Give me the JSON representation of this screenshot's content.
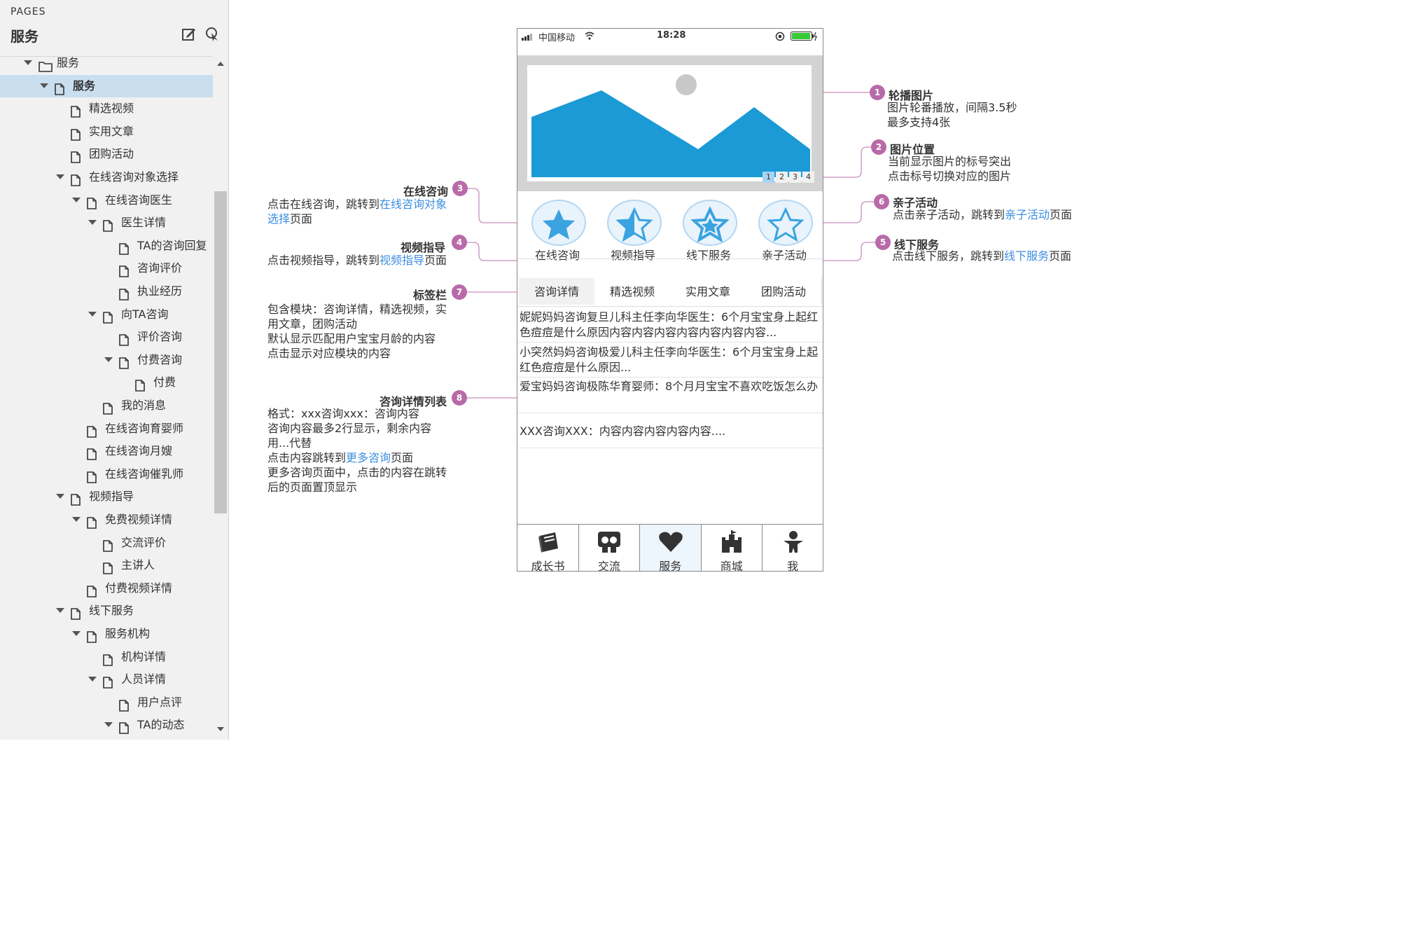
{
  "pages_panel": {
    "label": "PAGES",
    "title": "服务",
    "icons": [
      "edit-page-icon",
      "pointer-pick-icon"
    ],
    "tree": [
      {
        "label": "服务",
        "level": 0,
        "type": "folder",
        "expanded": true
      },
      {
        "label": "服务",
        "level": 1,
        "type": "page",
        "expanded": true,
        "selected": true
      },
      {
        "label": "精选视频",
        "level": 2,
        "type": "page"
      },
      {
        "label": "实用文章",
        "level": 2,
        "type": "page"
      },
      {
        "label": "团购活动",
        "level": 2,
        "type": "page"
      },
      {
        "label": "在线咨询对象选择",
        "level": 2,
        "type": "page",
        "expanded": true
      },
      {
        "label": "在线咨询医生",
        "level": 3,
        "type": "page",
        "expanded": true
      },
      {
        "label": "医生详情",
        "level": 4,
        "type": "page",
        "expanded": true
      },
      {
        "label": "TA的咨询回复",
        "level": 5,
        "type": "page"
      },
      {
        "label": "咨询评价",
        "level": 5,
        "type": "page"
      },
      {
        "label": "执业经历",
        "level": 5,
        "type": "page"
      },
      {
        "label": "向TA咨询",
        "level": 4,
        "type": "page",
        "expanded": true
      },
      {
        "label": "评价咨询",
        "level": 5,
        "type": "page"
      },
      {
        "label": "付费咨询",
        "level": 5,
        "type": "page",
        "expanded": true
      },
      {
        "label": "付费",
        "level": 6,
        "type": "page"
      },
      {
        "label": "我的消息",
        "level": 4,
        "type": "page"
      },
      {
        "label": "在线咨询育婴师",
        "level": 3,
        "type": "page"
      },
      {
        "label": "在线咨询月嫂",
        "level": 3,
        "type": "page"
      },
      {
        "label": "在线咨询催乳师",
        "level": 3,
        "type": "page"
      },
      {
        "label": "视频指导",
        "level": 2,
        "type": "page",
        "expanded": true
      },
      {
        "label": "免费视频详情",
        "level": 3,
        "type": "page",
        "expanded": true
      },
      {
        "label": "交流评价",
        "level": 4,
        "type": "page"
      },
      {
        "label": "主讲人",
        "level": 4,
        "type": "page"
      },
      {
        "label": "付费视频详情",
        "level": 3,
        "type": "page"
      },
      {
        "label": "线下服务",
        "level": 2,
        "type": "page",
        "expanded": true
      },
      {
        "label": "服务机构",
        "level": 3,
        "type": "page",
        "expanded": true
      },
      {
        "label": "机构详情",
        "level": 4,
        "type": "page"
      },
      {
        "label": "人员详情",
        "level": 4,
        "type": "page",
        "expanded": true
      },
      {
        "label": "用户点评",
        "level": 5,
        "type": "page"
      },
      {
        "label": "TA的动态",
        "level": 5,
        "type": "page",
        "expanded": true
      }
    ]
  },
  "phone": {
    "carrier": "中国移动",
    "time": "18:28",
    "carousel_dots": [
      "1",
      "2",
      "3",
      "4"
    ],
    "carousel_active_dot": 0,
    "shortcuts": [
      {
        "label": "在线咨询",
        "icon": "star-icon"
      },
      {
        "label": "视频指导",
        "icon": "half-star-icon"
      },
      {
        "label": "线下服务",
        "icon": "star-outline-icon"
      },
      {
        "label": "亲子活动",
        "icon": "star-hollow-icon"
      }
    ],
    "tabs": [
      "咨询详情",
      "精选视频",
      "实用文章",
      "团购活动"
    ],
    "active_tab": 0,
    "consult_items": [
      "妮妮妈妈咨询复旦儿科主任李向华医生：6个月宝宝身上起红色痘痘是什么原因内容内容内容内容内容内容内容...",
      "小突然妈妈咨询极爱儿科主任李向华医生：6个月宝宝身上起红色痘痘是什么原因...",
      "爱宝妈妈咨询极陈华育婴师：8个月月宝宝不喜欢吃饭怎么办",
      "XXX咨询XXX：内容内容内容内容内容...."
    ],
    "tabbar": [
      {
        "label": "成长书",
        "icon": "book-icon"
      },
      {
        "label": "交流",
        "icon": "chat-faces-icon"
      },
      {
        "label": "服务",
        "icon": "heart-icon"
      },
      {
        "label": "商城",
        "icon": "castle-icon"
      },
      {
        "label": "我",
        "icon": "person-icon"
      }
    ],
    "active_tabbar": 2
  },
  "annotations": {
    "a1": {
      "num": "1",
      "title": "轮播图片",
      "lines": [
        "图片轮番播放，间隔3.5秒",
        "最多支持4张"
      ]
    },
    "a2": {
      "num": "2",
      "title": "图片位置",
      "lines": [
        "当前显示图片的标号突出",
        "点击标号切换对应的图片"
      ]
    },
    "a3": {
      "num": "3",
      "title": "在线咨询",
      "text_pre": "点击在线咨询，跳转到",
      "link1": "在线咨询对象",
      "link2": "选择",
      "text_post": "页面"
    },
    "a4": {
      "num": "4",
      "title": "视频指导",
      "text_pre": "点击视频指导，跳转到",
      "link": "视频指导",
      "text_post": "页面"
    },
    "a5": {
      "num": "5",
      "title": "线下服务",
      "text_pre": "点击线下服务，跳转到",
      "link": "线下服务",
      "text_post": "页面"
    },
    "a6": {
      "num": "6",
      "title": "亲子活动",
      "text_pre": "点击亲子活动，跳转到",
      "link": "亲子活动",
      "text_post": "页面"
    },
    "a7": {
      "num": "7",
      "title": "标签栏",
      "lines": [
        "包含模块：咨询详情，精选视频，实",
        "用文章，团购活动",
        "默认显示匹配用户宝宝月龄的内容",
        "点击显示对应模块的内容"
      ]
    },
    "a8": {
      "num": "8",
      "title": "咨询详情列表",
      "lines_a": [
        "格式：xxx咨询xxx：咨询内容",
        "咨询内容最多2行显示，剩余内容",
        "用...代替"
      ],
      "text_pre": "点击内容跳转到",
      "link": "更多咨询",
      "text_post": "页面",
      "lines_b": [
        "更多咨询页面中，点击的内容在跳转",
        "后的页面置顶显示"
      ]
    }
  },
  "colors": {
    "accent_blue": "#1b9ad6",
    "badge_purple": "#b86aa8",
    "connector": "#c68fbe",
    "link": "#3b8ee0",
    "selected_row": "#c9dff0"
  }
}
